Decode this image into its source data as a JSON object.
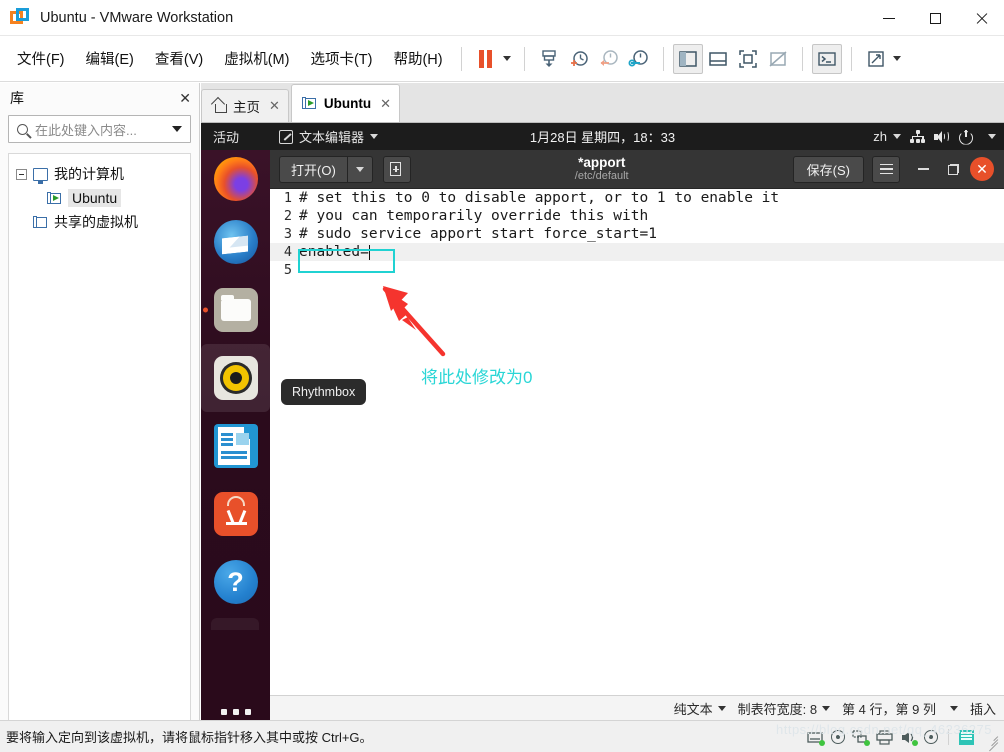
{
  "window": {
    "title": "Ubuntu - VMware Workstation",
    "app_icon": "vmware-logo-icon",
    "minimize": "—",
    "maximize": "□",
    "close": "✕"
  },
  "menubar": {
    "items": [
      {
        "label": "文件(F)",
        "name": "menu-file"
      },
      {
        "label": "编辑(E)",
        "name": "menu-edit"
      },
      {
        "label": "查看(V)",
        "name": "menu-view"
      },
      {
        "label": "虚拟机(M)",
        "name": "menu-vm"
      },
      {
        "label": "选项卡(T)",
        "name": "menu-tabs"
      },
      {
        "label": "帮助(H)",
        "name": "menu-help"
      }
    ]
  },
  "toolbar": {
    "buttons": [
      {
        "name": "suspend-button",
        "icon": "pause-icon"
      },
      {
        "name": "suspend-dropdown",
        "icon": "chevron-down-icon"
      },
      {
        "name": "power-options-button",
        "icon": "power-down-icon"
      },
      {
        "name": "snapshot-take-button",
        "icon": "snapshot-plus-icon"
      },
      {
        "name": "snapshot-revert-button",
        "icon": "snapshot-revert-icon"
      },
      {
        "name": "snapshot-manager-button",
        "icon": "snapshot-manager-icon"
      },
      {
        "name": "show-library-button",
        "icon": "sidebar-panel-icon"
      },
      {
        "name": "show-thumbnail-bar-button",
        "icon": "bottom-panel-icon"
      },
      {
        "name": "fullscreen-button",
        "icon": "fullscreen-icon"
      },
      {
        "name": "unity-mode-button",
        "icon": "unity-mode-icon"
      },
      {
        "name": "console-view-button",
        "icon": "terminal-icon"
      },
      {
        "name": "stretch-button",
        "icon": "expand-arrows-icon"
      },
      {
        "name": "stretch-dropdown",
        "icon": "chevron-down-icon"
      }
    ]
  },
  "library": {
    "title": "库",
    "close_label": "✕",
    "search_placeholder": "在此处键入内容...",
    "search_value": "",
    "tree": [
      {
        "label": "我的计算机",
        "level": 0,
        "icon": "monitor-icon",
        "expander": true,
        "selected": false
      },
      {
        "label": "Ubuntu",
        "level": 1,
        "icon": "vm-running-icon",
        "expander": false,
        "selected": true
      },
      {
        "label": "共享的虚拟机",
        "level": 0,
        "icon": "shared-vm-icon",
        "expander": false,
        "selected": false
      }
    ]
  },
  "tabs": [
    {
      "label": "主页",
      "icon": "home-icon",
      "active": false,
      "close": "✕"
    },
    {
      "label": "Ubuntu",
      "icon": "vm-running-icon",
      "active": true,
      "close": "✕"
    }
  ],
  "guest": {
    "topbar": {
      "activities": "活动",
      "app_name": "文本编辑器",
      "app_icon": "gedit-icon",
      "clock": "1月28日 星期四，18：33",
      "language": "zh",
      "icons": [
        "network-icon",
        "volume-icon",
        "power-icon",
        "chevron-down-icon"
      ]
    },
    "gedit": {
      "open_label": "打开(O)",
      "open_dropdown_icon": "chevron-down-icon",
      "new_tab_icon": "new-document-icon",
      "title": "*apport",
      "subtitle": "/etc/default",
      "save_label": "保存(S)",
      "menu_icon": "hamburger-icon",
      "minimize": "—",
      "maximize": "❐",
      "close": "✕"
    },
    "document": {
      "lines": [
        {
          "no": "1",
          "text": "# set this to 0 to disable apport, or to 1 to enable it"
        },
        {
          "no": "2",
          "text": "# you can temporarily override this with"
        },
        {
          "no": "3",
          "text": "# sudo service apport start force_start=1"
        },
        {
          "no": "4",
          "text": "enabled=",
          "current": true,
          "caret": true
        },
        {
          "no": "5",
          "text": ""
        }
      ]
    },
    "statusbar": {
      "language": "纯文本",
      "tab_width": "制表符宽度: 8",
      "position": "第 4 行，第 9 列",
      "insert_mode": "插入"
    },
    "dock": {
      "items": [
        {
          "name": "dock-item-firefox",
          "icon": "firefox-icon",
          "running": false,
          "active": false
        },
        {
          "name": "dock-item-thunderbird",
          "icon": "thunderbird-icon",
          "running": false,
          "active": false
        },
        {
          "name": "dock-item-files",
          "icon": "files-icon",
          "running": true,
          "active": false
        },
        {
          "name": "dock-item-rhythmbox",
          "icon": "rhythmbox-icon",
          "running": false,
          "active": true
        },
        {
          "name": "dock-item-libreoffice",
          "icon": "libreoffice-writer-icon",
          "running": false,
          "active": false
        },
        {
          "name": "dock-item-software",
          "icon": "ubuntu-software-icon",
          "running": false,
          "active": false
        },
        {
          "name": "dock-item-help",
          "icon": "help-icon",
          "running": false,
          "active": false
        },
        {
          "name": "dock-item-show-apps",
          "icon": "show-applications-icon",
          "running": false,
          "active": false
        }
      ],
      "tooltip": "Rhythmbox"
    }
  },
  "annotation": {
    "text": "将此处修改为0",
    "color": "#2ad6d6",
    "arrow_color": "#f5342e",
    "highlight_color": "#20d2d2"
  },
  "statusbar": {
    "hint": "要将输入定向到该虚拟机，请将鼠标指针移入其中或按 Ctrl+G。",
    "icons": [
      {
        "name": "hard-disk-icon",
        "led": true
      },
      {
        "name": "cd-dvd-icon",
        "led": false
      },
      {
        "name": "network-adapter-icon",
        "led": true
      },
      {
        "name": "printer-icon",
        "led": false
      },
      {
        "name": "sound-card-icon",
        "led": true
      },
      {
        "name": "usb-icon",
        "led": false
      },
      {
        "name": "shared-folders-icon",
        "led": false
      }
    ],
    "watermark": "https://blog.csdn.net/qq_46236275"
  },
  "colors": {
    "accent_orange": "#e8502a",
    "vmware_blue": "#1a9dd9",
    "dock_bg": "#2c0b1e",
    "gnome_bar": "#1c1c1c",
    "gedit_header": "#353535"
  }
}
